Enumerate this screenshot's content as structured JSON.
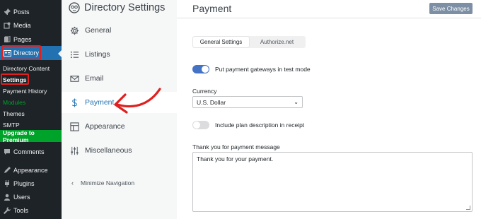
{
  "wp_menu": {
    "items": [
      {
        "label": "Posts",
        "icon": "pin-icon"
      },
      {
        "label": "Media",
        "icon": "media-icon"
      },
      {
        "label": "Pages",
        "icon": "pages-icon"
      },
      {
        "label": "Directory",
        "icon": "directory-icon"
      }
    ],
    "submenu": [
      "Directory Content",
      "Settings",
      "Payment History",
      "Modules",
      "Themes",
      "SMTP"
    ],
    "upgrade": "Upgrade to Premium",
    "lower_items": [
      {
        "label": "Comments",
        "icon": "comments-icon"
      },
      {
        "label": "Appearance",
        "icon": "appearance-icon"
      },
      {
        "label": "Plugins",
        "icon": "plugins-icon"
      },
      {
        "label": "Users",
        "icon": "users-icon"
      },
      {
        "label": "Tools",
        "icon": "tools-icon"
      }
    ],
    "colors": {
      "bg": "#1d2327",
      "active": "#2271b1",
      "green": "#00a32a",
      "highlight_box": "#e02020"
    }
  },
  "directory_nav": {
    "title": "Directory Settings",
    "items": [
      {
        "label": "General",
        "icon": "gear-icon"
      },
      {
        "label": "Listings",
        "icon": "list-icon"
      },
      {
        "label": "Email",
        "icon": "email-icon"
      },
      {
        "label": "Payment",
        "icon": "dollar-icon"
      },
      {
        "label": "Appearance",
        "icon": "layout-icon"
      },
      {
        "label": "Miscellaneous",
        "icon": "sliders-icon"
      }
    ],
    "minimize": "Minimize Navigation"
  },
  "main": {
    "title": "Payment",
    "save_label": "Save Changes",
    "tabs": [
      "General Settings",
      "Authorize.net"
    ],
    "test_mode_label": "Put payment gateways in test mode",
    "test_mode_on": true,
    "currency_label": "Currency",
    "currency_value": "U.S. Dollar",
    "plan_desc_label": "Include plan description in receipt",
    "plan_desc_on": false,
    "thankyou_label": "Thank you for payment message",
    "thankyou_value": "Thank you for your payment.",
    "colors": {
      "accent": "#4472c4",
      "save_button": "#7d8fa5",
      "arrow": "#e02020"
    }
  }
}
